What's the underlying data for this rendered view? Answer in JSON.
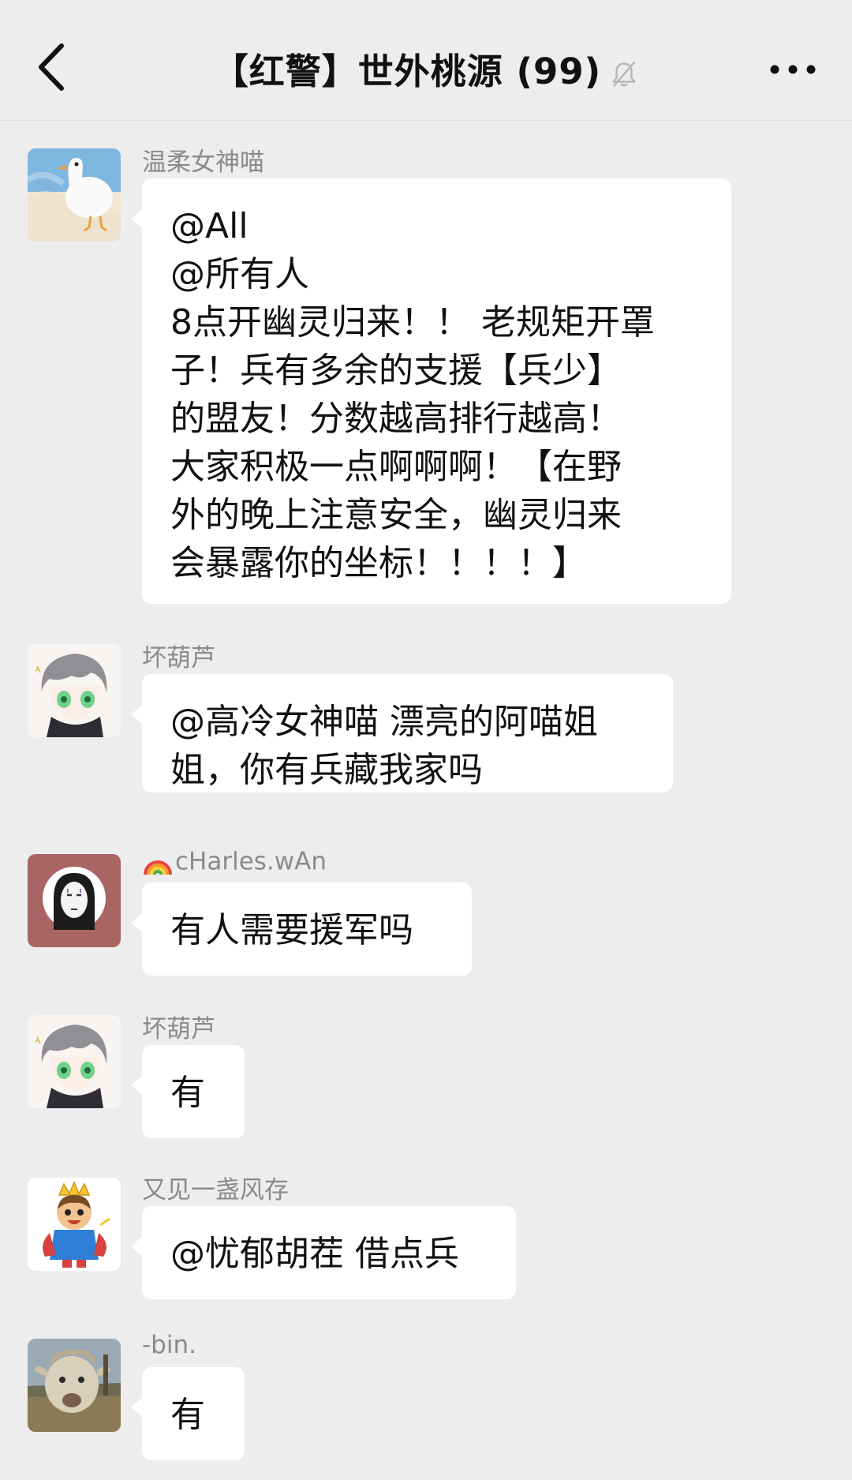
{
  "header": {
    "title": "【红警】世外桃源 (99)",
    "back_icon": "chevron-left-icon",
    "mute_icon": "bell-muted-icon",
    "more_icon": "more-dots-icon"
  },
  "messages": [
    {
      "sender": "温柔女神喵",
      "avatar": "duck-avatar",
      "lines": [
        "@All",
        "@所有人",
        "8点开幽灵归来！！ 老规矩开罩",
        "子！兵有多余的支援【兵少】",
        "的盟友！分数越高排行越高！",
        "大家积极一点啊啊啊！【在野",
        "外的晚上注意安全，幽灵归来",
        "会暴露你的坐标！！！！】"
      ]
    },
    {
      "sender": "坏葫芦",
      "avatar": "anime-boy-avatar",
      "lines": [
        "@高冷女神喵 漂亮的阿喵姐",
        "姐，你有兵藏我家吗"
      ]
    },
    {
      "sender": "cHarles.wAn",
      "sender_prefix_icon": "rainbow-icon",
      "avatar": "no-face-avatar",
      "lines": [
        "有人需要援军吗"
      ]
    },
    {
      "sender": "坏葫芦",
      "avatar": "anime-boy-avatar",
      "lines": [
        "有"
      ]
    },
    {
      "sender": "又见一盏风存",
      "avatar": "cartoon-king-avatar",
      "lines": [
        "@忧郁胡茬 借点兵"
      ]
    },
    {
      "sender": "-bin.",
      "avatar": "goat-avatar",
      "lines": [
        "有"
      ]
    }
  ],
  "colors": {
    "background": "#ededed",
    "bubble": "#ffffff",
    "sender_text": "#8a8a8a",
    "message_text": "#111111"
  }
}
